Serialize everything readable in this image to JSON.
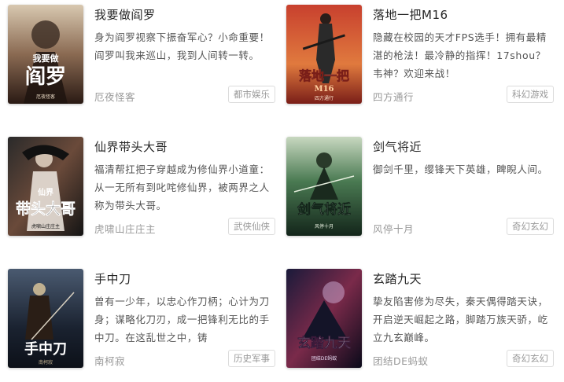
{
  "books": [
    {
      "title": "我要做阎罗",
      "description": "身为阎罗视察下振奋军心？小命重要！阎罗叫我来巡山，我到人间转一转。",
      "author": "厄夜怪客",
      "tag": "都市娱乐",
      "cover_text": "阎罗",
      "cover_subtext": "我要做",
      "cover_author": "厄夜怪客",
      "cover_colors": [
        "#3a2a22",
        "#8a6a52",
        "#e8d9c4"
      ]
    },
    {
      "title": "落地一把M16",
      "description": "隐藏在校园的天才FPS选手！拥有最精湛的枪法！最冷静的指挥！17shou？韦神？欢迎来战！",
      "author": "四方通行",
      "tag": "科幻游戏",
      "cover_text": "落地一把",
      "cover_subtext": "M16",
      "cover_author": "四方通行",
      "cover_colors": [
        "#b8302a",
        "#e07a3e",
        "#2a2a2a"
      ]
    },
    {
      "title": "仙界带头大哥",
      "description": "福清帮扛把子穿越成为修仙界小道童：从一无所有到叱咤修仙界，被两界之人称为带头大哥。",
      "author": "虎啸山庄庄主",
      "tag": "武侠仙侠",
      "cover_text": "带头大哥",
      "cover_subtext": "仙界",
      "cover_author": "虎啸山庄庄主",
      "cover_colors": [
        "#1a1a1a",
        "#6a4a3a",
        "#d0c0b0"
      ]
    },
    {
      "title": "剑气将近",
      "description": "御剑千里，缨锋天下英雄，睥睨人间。",
      "author": "风停十月",
      "tag": "奇幻玄幻",
      "cover_text": "剑气将近",
      "cover_subtext": "",
      "cover_author": "风停十月",
      "cover_colors": [
        "#1e3a2a",
        "#4a7a52",
        "#c8d8c0"
      ]
    },
    {
      "title": "手中刀",
      "description": "曾有一少年，以忠心作刀柄；心计为刀身；谋略化刀刃，成一把锋利无比的手中刀。在这乱世之中，铸",
      "author": "南柯寂",
      "tag": "历史军事",
      "cover_text": "手中刀",
      "cover_subtext": "",
      "cover_author": "南柯寂",
      "cover_colors": [
        "#1a2230",
        "#4a5a70",
        "#c0b090"
      ]
    },
    {
      "title": "玄踏九天",
      "description": "挚友陷害修为尽失，秦天偶得踏天诀，开启逆天崛起之路，脚踏万族天骄，屹立九玄巅峰。",
      "author": "团结DE蚂蚁",
      "tag": "奇幻玄幻",
      "cover_text": "玄踏九天",
      "cover_subtext": "",
      "cover_author": "团结DE蚂蚁",
      "cover_colors": [
        "#1a1a3a",
        "#7a2a4a",
        "#d0b0d8"
      ]
    }
  ]
}
